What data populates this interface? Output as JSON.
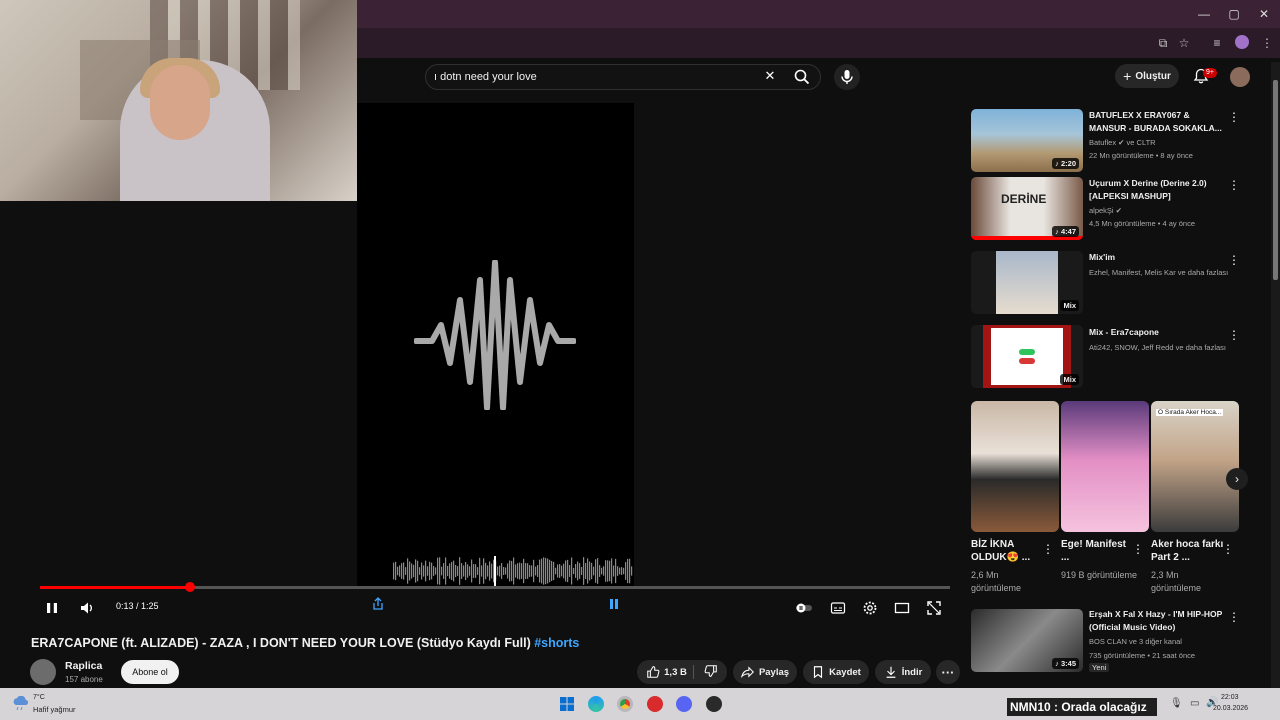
{
  "browser": {
    "window_controls": [
      "—",
      "▢",
      "✕"
    ]
  },
  "search": {
    "query": "ı dotn need your love"
  },
  "header": {
    "create_label": "Oluştur",
    "notification_badge": "9+"
  },
  "player": {
    "time": "0:13 / 1:25",
    "progress": 0.165
  },
  "video": {
    "title": "ERA7CAPONE (ft. ALIZADE) - ZAZA , I DON'T NEED YOUR LOVE (Stüdyo Kaydı Full)",
    "hashtag": "#shorts",
    "channel_name": "Raplica",
    "channel_subs": "157 abone",
    "subscribe_label": "Abone ol",
    "like_count": "1,3 B",
    "share_label": "Paylaş",
    "save_label": "Kaydet",
    "download_label": "İndir"
  },
  "recommendations": [
    {
      "title": "BATUFLEX X ERAY067 & MANSUR - BURADA SOKAKLA...",
      "channel": "Batuflex ✔ ve CLTR",
      "meta": "22 Mn görüntüleme • 8 ay önce",
      "duration": "♪ 2:20"
    },
    {
      "title": "Uçurum X Derine (Derine 2.0) [ALPEKSI MASHUP]",
      "channel": "alpekŞi ✔",
      "meta": "4,5 Mn görüntüleme • 4 ay önce",
      "duration": "♪ 4:47"
    },
    {
      "title": "Mix'im",
      "channel": "Ezhel, Manifest, Melis Kar ve daha fazlası",
      "meta": "",
      "duration": "Mix"
    },
    {
      "title": "Mix - Era7capone",
      "channel": "Ati242, SNOW, Jeff Redd ve daha fazlası",
      "meta": "",
      "duration": "Mix"
    },
    {
      "title": "Erşah X Fal X Hazy - I'M HIP-HOP (Official Music Video)",
      "channel": "BOS CLAN ve 3 diğer kanal",
      "meta": "735 görüntüleme • 21 saat önce",
      "duration": "♪ 3:45",
      "badge": "Yeni"
    }
  ],
  "shorts": [
    {
      "title": "BİZ İKNA OLDUK😍 ...",
      "views": "2,6 Mn görüntüleme"
    },
    {
      "title": "Ege! Manifest ...",
      "views": "919 B görüntüleme"
    },
    {
      "title": "Aker hoca farkı Part 2 ...",
      "views": "2,3 Mn görüntüleme",
      "overlay": "O Sırada Aker Hoca..."
    }
  ],
  "taskbar": {
    "weather_temp": "7°C",
    "weather_text": "Hafif yağmur",
    "ticker": "NMN10 : Orada olacağız",
    "time": "22:03",
    "date": "20.03.2026"
  }
}
